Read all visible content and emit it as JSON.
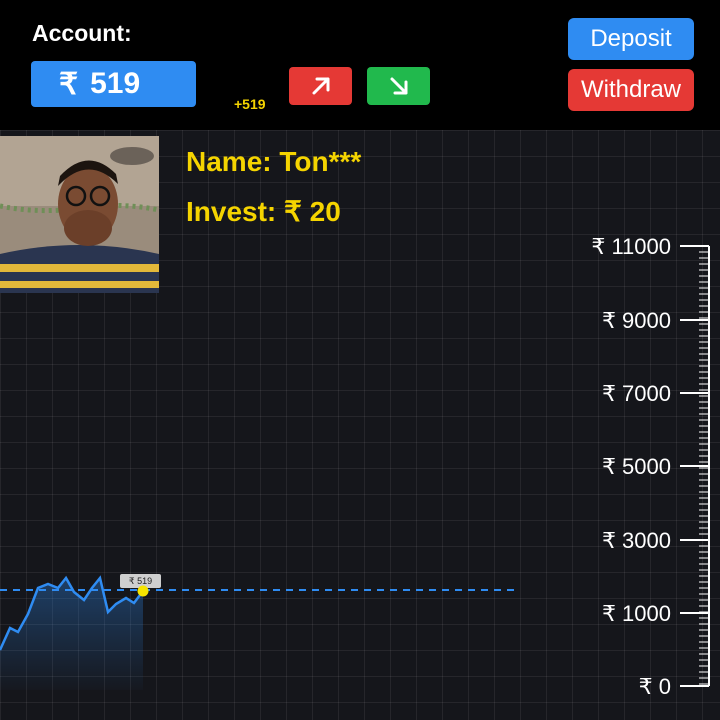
{
  "account": {
    "label": "Account:",
    "currency": "₹",
    "balance": "519",
    "delta": "+519"
  },
  "buttons": {
    "deposit": "Deposit",
    "withdraw": "Withdraw",
    "up_icon": "arrow-up-right-icon",
    "down_icon": "arrow-down-right-icon"
  },
  "player": {
    "name": "Name: Ton***",
    "invest": "Invest: ₹ 20"
  },
  "chart_data": {
    "type": "line",
    "y_tick_labels": [
      "₹ 11000",
      "₹ 9000",
      "₹ 7000",
      "₹ 5000",
      "₹ 3000",
      "₹ 1000",
      "₹ 0"
    ],
    "current_marker_label": "₹ 519",
    "current_value": 519
  },
  "colors": {
    "accent_blue": "#2f8cf2",
    "down_red": "#e53935",
    "up_green": "#21b94d",
    "highlight_yellow": "#f5d400"
  }
}
